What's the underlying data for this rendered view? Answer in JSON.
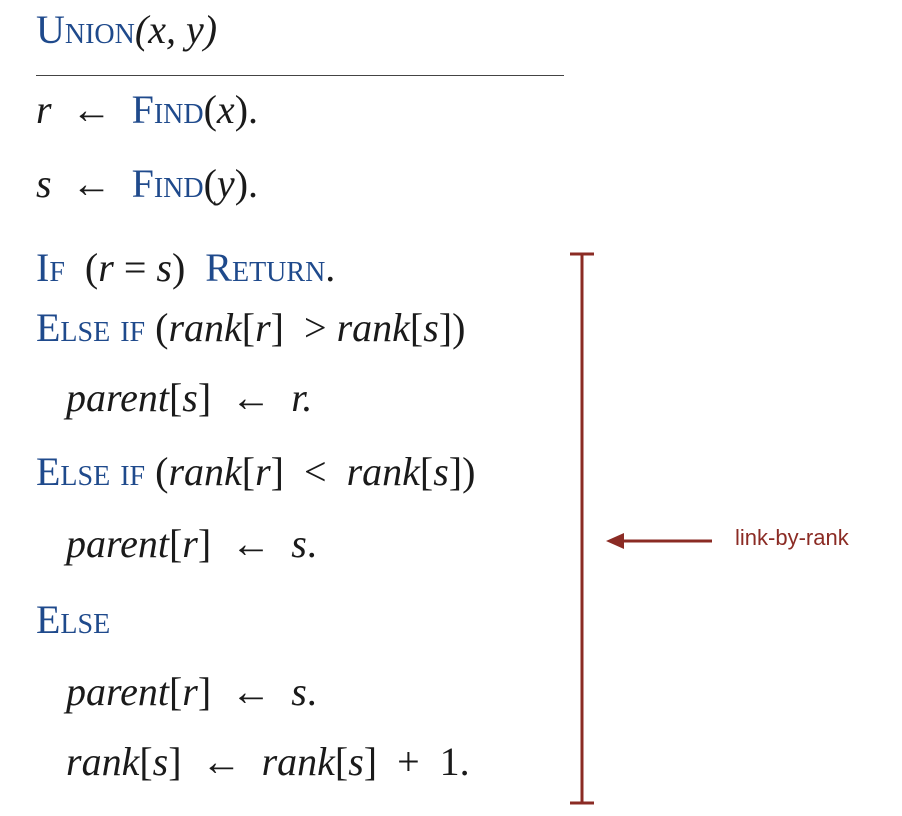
{
  "header": {
    "kw": "Union",
    "args": "(x, y)"
  },
  "lines": [
    {
      "id": "find-x",
      "parts": [
        {
          "t": "r",
          "s": "it"
        },
        {
          "t": "  ←  ",
          "s": ""
        },
        {
          "t": "Find",
          "s": "kw"
        },
        {
          "t": "(",
          "s": ""
        },
        {
          "t": "x",
          "s": "it"
        },
        {
          "t": ").",
          "s": ""
        }
      ]
    },
    {
      "id": "find-y",
      "parts": [
        {
          "t": "s",
          "s": "it"
        },
        {
          "t": "  ←  ",
          "s": ""
        },
        {
          "t": "Find",
          "s": "kw"
        },
        {
          "t": "(",
          "s": ""
        },
        {
          "t": "y",
          "s": "it"
        },
        {
          "t": ").",
          "s": ""
        }
      ]
    },
    {
      "id": "if-equal",
      "parts": [
        {
          "t": "If",
          "s": "kw"
        },
        {
          "t": "  (",
          "s": ""
        },
        {
          "t": "r",
          "s": "it"
        },
        {
          "t": " = ",
          "s": ""
        },
        {
          "t": "s",
          "s": "it"
        },
        {
          "t": ")  ",
          "s": ""
        },
        {
          "t": "Return",
          "s": "kw"
        },
        {
          "t": ".",
          "s": ""
        }
      ]
    },
    {
      "id": "elseif-greater",
      "parts": [
        {
          "t": "Else if",
          "s": "kw"
        },
        {
          "t": " (",
          "s": ""
        },
        {
          "t": "rank",
          "s": "it"
        },
        {
          "t": "[",
          "s": ""
        },
        {
          "t": "r",
          "s": "it"
        },
        {
          "t": "]  > ",
          "s": ""
        },
        {
          "t": "rank",
          "s": "it"
        },
        {
          "t": "[",
          "s": ""
        },
        {
          "t": "s",
          "s": "it"
        },
        {
          "t": "])",
          "s": ""
        }
      ]
    },
    {
      "id": "parent-s",
      "parts": [
        {
          "t": "   ",
          "s": ""
        },
        {
          "t": "parent",
          "s": "it"
        },
        {
          "t": "[",
          "s": ""
        },
        {
          "t": "s",
          "s": "it"
        },
        {
          "t": "]  ←  ",
          "s": ""
        },
        {
          "t": "r.",
          "s": "it"
        }
      ]
    },
    {
      "id": "elseif-less",
      "parts": [
        {
          "t": "Else if",
          "s": "kw"
        },
        {
          "t": " (",
          "s": ""
        },
        {
          "t": "rank",
          "s": "it"
        },
        {
          "t": "[",
          "s": ""
        },
        {
          "t": "r",
          "s": "it"
        },
        {
          "t": "]  <  ",
          "s": ""
        },
        {
          "t": "rank",
          "s": "it"
        },
        {
          "t": "[",
          "s": ""
        },
        {
          "t": "s",
          "s": "it"
        },
        {
          "t": "])",
          "s": ""
        }
      ]
    },
    {
      "id": "parent-r-1",
      "parts": [
        {
          "t": "   ",
          "s": ""
        },
        {
          "t": "parent",
          "s": "it"
        },
        {
          "t": "[",
          "s": ""
        },
        {
          "t": "r",
          "s": "it"
        },
        {
          "t": "]  ←  ",
          "s": ""
        },
        {
          "t": "s",
          "s": "it"
        },
        {
          "t": ".",
          "s": ""
        }
      ]
    },
    {
      "id": "else",
      "parts": [
        {
          "t": "Else",
          "s": "kw"
        }
      ]
    },
    {
      "id": "parent-r-2",
      "parts": [
        {
          "t": "   ",
          "s": ""
        },
        {
          "t": "parent",
          "s": "it"
        },
        {
          "t": "[",
          "s": ""
        },
        {
          "t": "r",
          "s": "it"
        },
        {
          "t": "]  ←  ",
          "s": ""
        },
        {
          "t": "s",
          "s": "it"
        },
        {
          "t": ".",
          "s": ""
        }
      ]
    },
    {
      "id": "rank-increment",
      "parts": [
        {
          "t": "   ",
          "s": ""
        },
        {
          "t": "rank",
          "s": "it"
        },
        {
          "t": "[",
          "s": ""
        },
        {
          "t": "s",
          "s": "it"
        },
        {
          "t": "]  ←  ",
          "s": ""
        },
        {
          "t": "rank",
          "s": "it"
        },
        {
          "t": "[",
          "s": ""
        },
        {
          "t": "s",
          "s": "it"
        },
        {
          "t": "]  +  1.",
          "s": ""
        }
      ]
    }
  ],
  "annotation": {
    "label": "link-by-rank",
    "color": "#8b2b24"
  },
  "colors": {
    "keyword": "#1f4a8c",
    "text": "#1a1a1a"
  }
}
